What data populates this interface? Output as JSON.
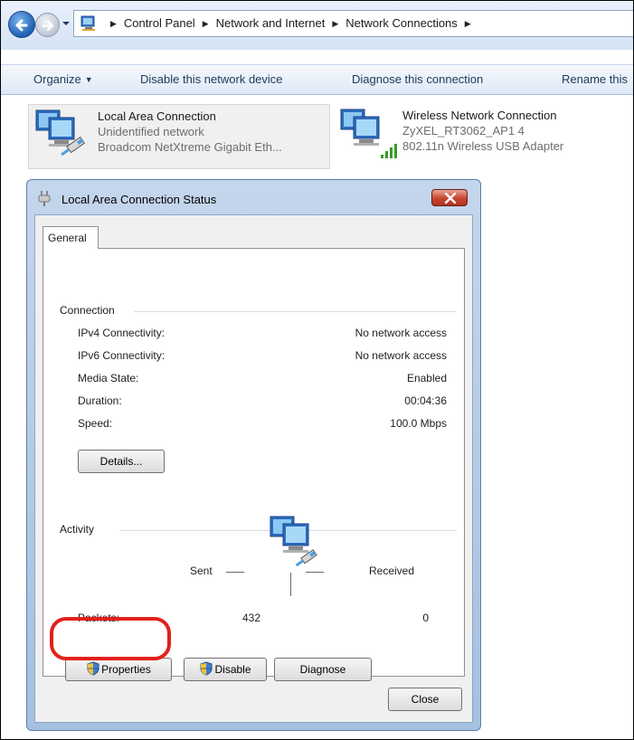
{
  "explorer": {
    "breadcrumbs": [
      "Control Panel",
      "Network and Internet",
      "Network Connections"
    ],
    "toolbar": {
      "organize": "Organize",
      "disable_device": "Disable this network device",
      "diagnose": "Diagnose this connection",
      "rename": "Rename this"
    },
    "adapters": [
      {
        "name": "Local Area Connection",
        "status": "Unidentified network",
        "device": "Broadcom NetXtreme Gigabit Eth..."
      },
      {
        "name": "Wireless Network Connection",
        "status": "ZyXEL_RT3062_AP1  4",
        "device": "802.11n Wireless USB Adapter"
      }
    ]
  },
  "dialog": {
    "title": "Local Area Connection Status",
    "tab": "General",
    "connection": {
      "group_label": "Connection",
      "rows": [
        {
          "label": "IPv4 Connectivity:",
          "value": "No network access"
        },
        {
          "label": "IPv6 Connectivity:",
          "value": "No network access"
        },
        {
          "label": "Media State:",
          "value": "Enabled"
        },
        {
          "label": "Duration:",
          "value": "00:04:36"
        },
        {
          "label": "Speed:",
          "value": "100.0 Mbps"
        }
      ],
      "details_button": "Details..."
    },
    "activity": {
      "group_label": "Activity",
      "sent_label": "Sent",
      "received_label": "Received",
      "packets_label": "Packets:",
      "packets_sent": "432",
      "packets_received": "0"
    },
    "buttons": {
      "properties": "Properties",
      "disable": "Disable",
      "diagnose": "Diagnose",
      "close": "Close"
    }
  },
  "colors": {
    "highlight_ring": "#e2211c",
    "toolbar_text": "#1e395b",
    "close_button": "#c7452f"
  }
}
